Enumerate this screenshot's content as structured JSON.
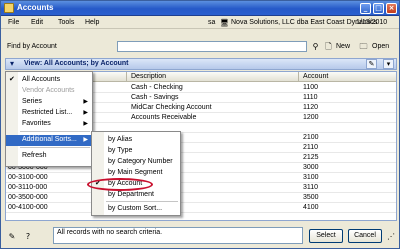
{
  "window": {
    "title": "Accounts"
  },
  "menu": {
    "items": [
      "File",
      "Edit",
      "Tools",
      "Help"
    ]
  },
  "header": {
    "user": "sa",
    "company": "Nova Solutions, LLC dba East Coast Dynamics",
    "date": "1/13/2010"
  },
  "find": {
    "label": "Find by Account",
    "input_value": "",
    "new_label": "New",
    "open_label": "Open"
  },
  "view": {
    "title": "View: All Accounts; by Account"
  },
  "grid": {
    "columns": [
      "Description",
      "Account"
    ],
    "rows": [
      {
        "account_number": "",
        "description": "Cash - Checking",
        "account": "1100"
      },
      {
        "account_number": "",
        "description": "Cash - Savings",
        "account": "1110"
      },
      {
        "account_number": "",
        "description": "MidCar Checking Account",
        "account": "1120"
      },
      {
        "account_number": "",
        "description": "Accounts Receivable",
        "account": "1200"
      },
      {
        "account_number": "",
        "description": "",
        "account": ""
      },
      {
        "account_number": "",
        "description": "le",
        "account": "2100"
      },
      {
        "account_number": "",
        "description": "able",
        "account": "2110"
      },
      {
        "account_number": "00-2125-000",
        "description": "",
        "account": "2125"
      },
      {
        "account_number": "00-3000-000",
        "description": "",
        "account": "3000"
      },
      {
        "account_number": "00-3100-000",
        "description": "gs",
        "account": "3100"
      },
      {
        "account_number": "00-3110-000",
        "description": "n Capital",
        "account": "3110"
      },
      {
        "account_number": "00-3500-000",
        "description": "",
        "account": "3500"
      },
      {
        "account_number": "00-4100-000",
        "description": "",
        "account": "4100"
      }
    ]
  },
  "context_menu": {
    "items": [
      {
        "label": "All Accounts",
        "checked": true,
        "disabled": false,
        "submenu": false
      },
      {
        "label": "Vendor Accounts",
        "checked": false,
        "disabled": true,
        "submenu": false
      },
      {
        "label": "Series",
        "checked": false,
        "disabled": false,
        "submenu": true
      },
      {
        "label": "Restricted List...",
        "checked": false,
        "disabled": false,
        "submenu": true
      },
      {
        "label": "Favorites",
        "checked": false,
        "disabled": false,
        "submenu": true
      },
      {
        "label": "Additional Sorts...",
        "checked": false,
        "disabled": false,
        "submenu": true,
        "highlighted": true
      },
      {
        "label": "Refresh",
        "checked": false,
        "disabled": false,
        "submenu": false
      }
    ]
  },
  "sort_menu": {
    "items": [
      {
        "label": "by Alias",
        "checked": false
      },
      {
        "label": "by Type",
        "checked": false
      },
      {
        "label": "by Category Number",
        "checked": false
      },
      {
        "label": "by Main Segment",
        "checked": false
      },
      {
        "label": "by Account",
        "checked": true
      },
      {
        "label": "by Department",
        "checked": false
      },
      {
        "label": "by Custom Sort...",
        "checked": false
      }
    ]
  },
  "status": {
    "text": "All records with no search criteria."
  },
  "buttons": {
    "select": "Select",
    "cancel": "Cancel"
  }
}
